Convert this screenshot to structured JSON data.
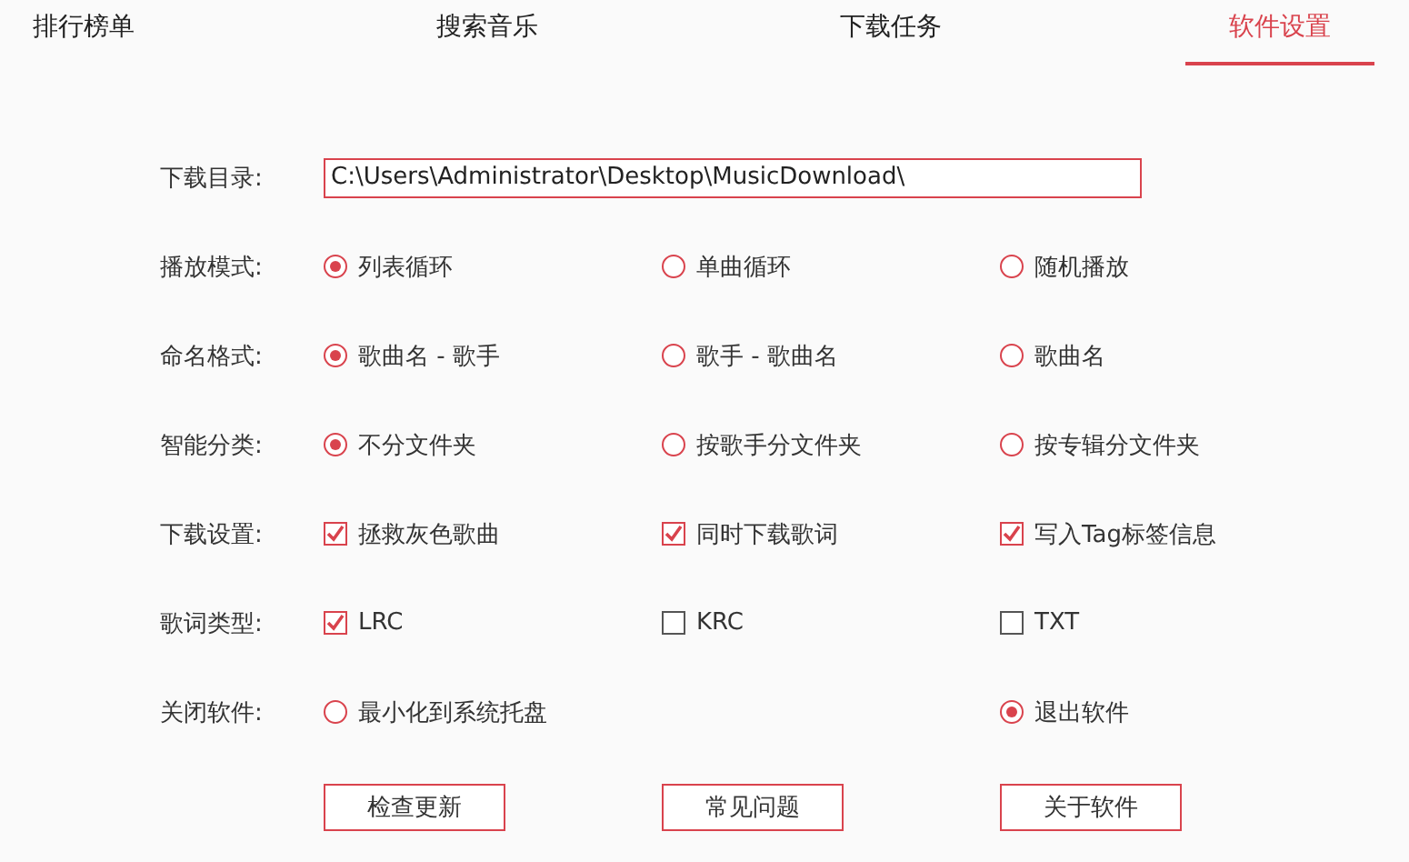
{
  "tabs": [
    {
      "label": "排行榜单",
      "selected": false
    },
    {
      "label": "搜索音乐",
      "selected": false
    },
    {
      "label": "下载任务",
      "selected": false
    },
    {
      "label": "软件设置",
      "selected": true
    }
  ],
  "settings": [
    {
      "kind": "path",
      "label": "下载目录:",
      "value": "C:\\Users\\Administrator\\Desktop\\MusicDownload\\"
    },
    {
      "kind": "radio",
      "label": "播放模式:",
      "options": [
        {
          "label": "列表循环",
          "selected": true
        },
        {
          "label": "单曲循环",
          "selected": false
        },
        {
          "label": "随机播放",
          "selected": false
        }
      ]
    },
    {
      "kind": "radio",
      "label": "命名格式:",
      "options": [
        {
          "label": "歌曲名 - 歌手",
          "selected": true
        },
        {
          "label": "歌手 - 歌曲名",
          "selected": false
        },
        {
          "label": "歌曲名",
          "selected": false
        }
      ]
    },
    {
      "kind": "radio",
      "label": "智能分类:",
      "options": [
        {
          "label": "不分文件夹",
          "selected": true
        },
        {
          "label": "按歌手分文件夹",
          "selected": false
        },
        {
          "label": "按专辑分文件夹",
          "selected": false
        }
      ]
    },
    {
      "kind": "check",
      "label": "下载设置:",
      "options": [
        {
          "label": "拯救灰色歌曲",
          "checked": true
        },
        {
          "label": "同时下载歌词",
          "checked": true
        },
        {
          "label": "写入Tag标签信息",
          "checked": true
        }
      ]
    },
    {
      "kind": "check",
      "label": "歌词类型:",
      "options": [
        {
          "label": "LRC",
          "checked": true
        },
        {
          "label": "KRC",
          "checked": false
        },
        {
          "label": "TXT",
          "checked": false
        }
      ]
    },
    {
      "kind": "radio",
      "label": "关闭软件:",
      "options": [
        {
          "label": "最小化到系统托盘",
          "selected": false
        },
        {
          "label": "退出软件",
          "selected": true
        }
      ]
    }
  ],
  "buttons": [
    "检查更新",
    "常见问题",
    "关于软件"
  ]
}
